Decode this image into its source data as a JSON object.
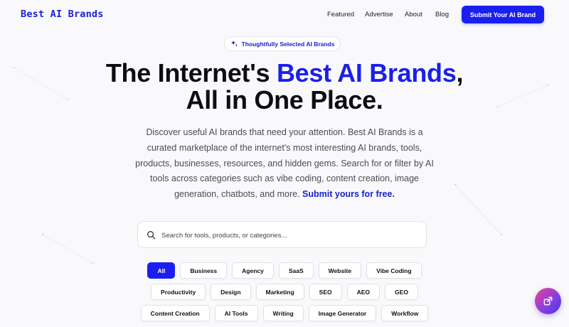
{
  "brand": {
    "logo": "Best AI Brands",
    "accent_color": "#1b20e8"
  },
  "nav": {
    "items": [
      "Featured",
      "Advertise",
      "About",
      "Blog"
    ],
    "cta": "Submit Your AI Brand"
  },
  "hero": {
    "pill": "Thoughtfully Selected AI Brands",
    "headline_pre": "The Internet's ",
    "headline_accent": "Best AI Brands",
    "headline_comma": ",",
    "headline_line2": "All in One Place.",
    "description": "Discover useful AI brands that need your attention. Best AI Brands is a curated marketplace of the internet's most interesting AI brands, tools, products, businesses, resources, and hidden gems. Search for or filter by AI tools across categories such as vibe coding, content creation, image generation, chatbots, and more. ",
    "description_cta": "Submit yours for free."
  },
  "search": {
    "placeholder": "Search for tools, products, or categories..."
  },
  "categories": {
    "row1": [
      "All",
      "Business",
      "Agency",
      "SaaS",
      "Website",
      "Vibe Coding"
    ],
    "row2": [
      "Productivity",
      "Design",
      "Marketing",
      "SEO",
      "AEO",
      "GEO"
    ],
    "row3": [
      "Content Creation",
      "AI Tools",
      "Writing",
      "Image Generator",
      "Workflow"
    ],
    "active": "All"
  },
  "fab": {
    "icon": "external-share-icon"
  }
}
